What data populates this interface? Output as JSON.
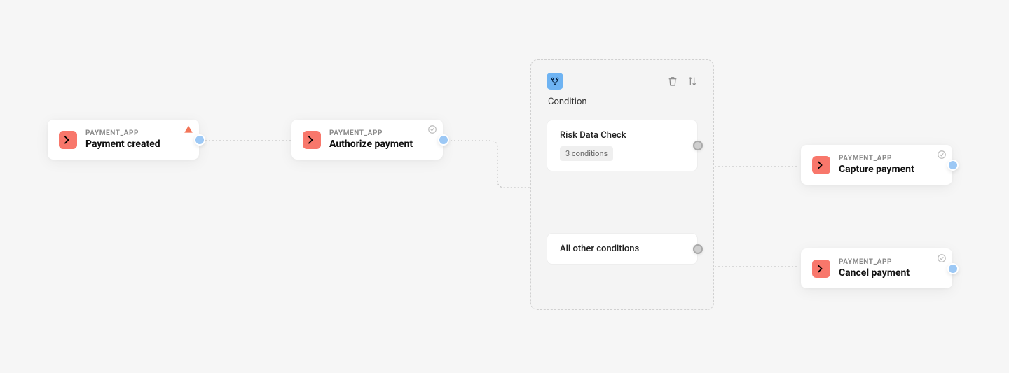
{
  "nodes": {
    "start": {
      "tag": "PAYMENT_APP",
      "title": "Payment created"
    },
    "authorize": {
      "tag": "PAYMENT_APP",
      "title": "Authorize payment"
    },
    "capture": {
      "tag": "PAYMENT_APP",
      "title": "Capture payment"
    },
    "cancel": {
      "tag": "PAYMENT_APP",
      "title": "Cancel payment"
    }
  },
  "condition": {
    "label": "Condition",
    "branches": {
      "risk": {
        "title": "Risk Data Check",
        "chip": "3 conditions"
      },
      "fallback": {
        "title": "All other conditions"
      }
    }
  }
}
